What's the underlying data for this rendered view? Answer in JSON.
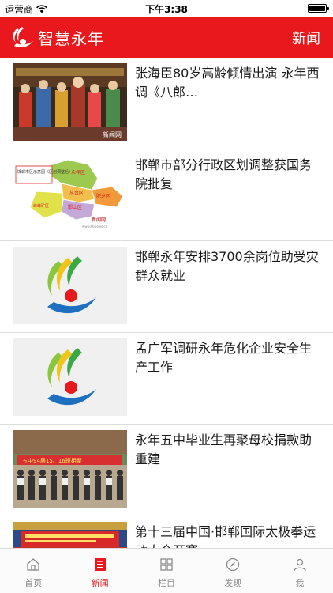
{
  "status_bar": {
    "carrier": "运营商",
    "time": "下午3:38"
  },
  "header": {
    "brand": "智慧永年",
    "section": "新闻"
  },
  "news": [
    {
      "title": "张海臣80岁高龄倾情出演 永年西调《八郎…",
      "thumb": "opera-photo"
    },
    {
      "title": "邯郸市部分行政区划调整获国务院批复",
      "thumb": "map-photo"
    },
    {
      "title": "邯郸永年安排3700余岗位助受灾群众就业",
      "thumb": "logo-placeholder"
    },
    {
      "title": "孟广军调研永年危化企业安全生产工作",
      "thumb": "logo-placeholder"
    },
    {
      "title": "永年五中毕业生再聚母校捐款助重建",
      "thumb": "group-photo"
    },
    {
      "title": "第十三届中国·邯郸国际太极拳运动大会开赛",
      "thumb": "event-photo"
    }
  ],
  "map_labels": {
    "box": "邯郸市区示意图（区划调整后）",
    "yongnian": "永年区",
    "congtai": "丛台区",
    "feixiang": "肥乡区",
    "handan": "邯山区",
    "fengfeng": "峰峰矿区",
    "watermark": "新闻网",
    "url": "www.hbnews.cn"
  },
  "photo_text": {
    "opera_watermark": "新闻网",
    "school_banner": "五中94届15、16班相聚"
  },
  "tabs": [
    {
      "label": "首页",
      "icon": "home-icon"
    },
    {
      "label": "新闻",
      "icon": "news-icon",
      "active": true
    },
    {
      "label": "栏目",
      "icon": "grid-icon"
    },
    {
      "label": "发现",
      "icon": "compass-icon"
    },
    {
      "label": "我",
      "icon": "person-icon"
    }
  ],
  "colors": {
    "brand_red": "#e8181c",
    "tab_inactive": "#8a8a8a"
  }
}
